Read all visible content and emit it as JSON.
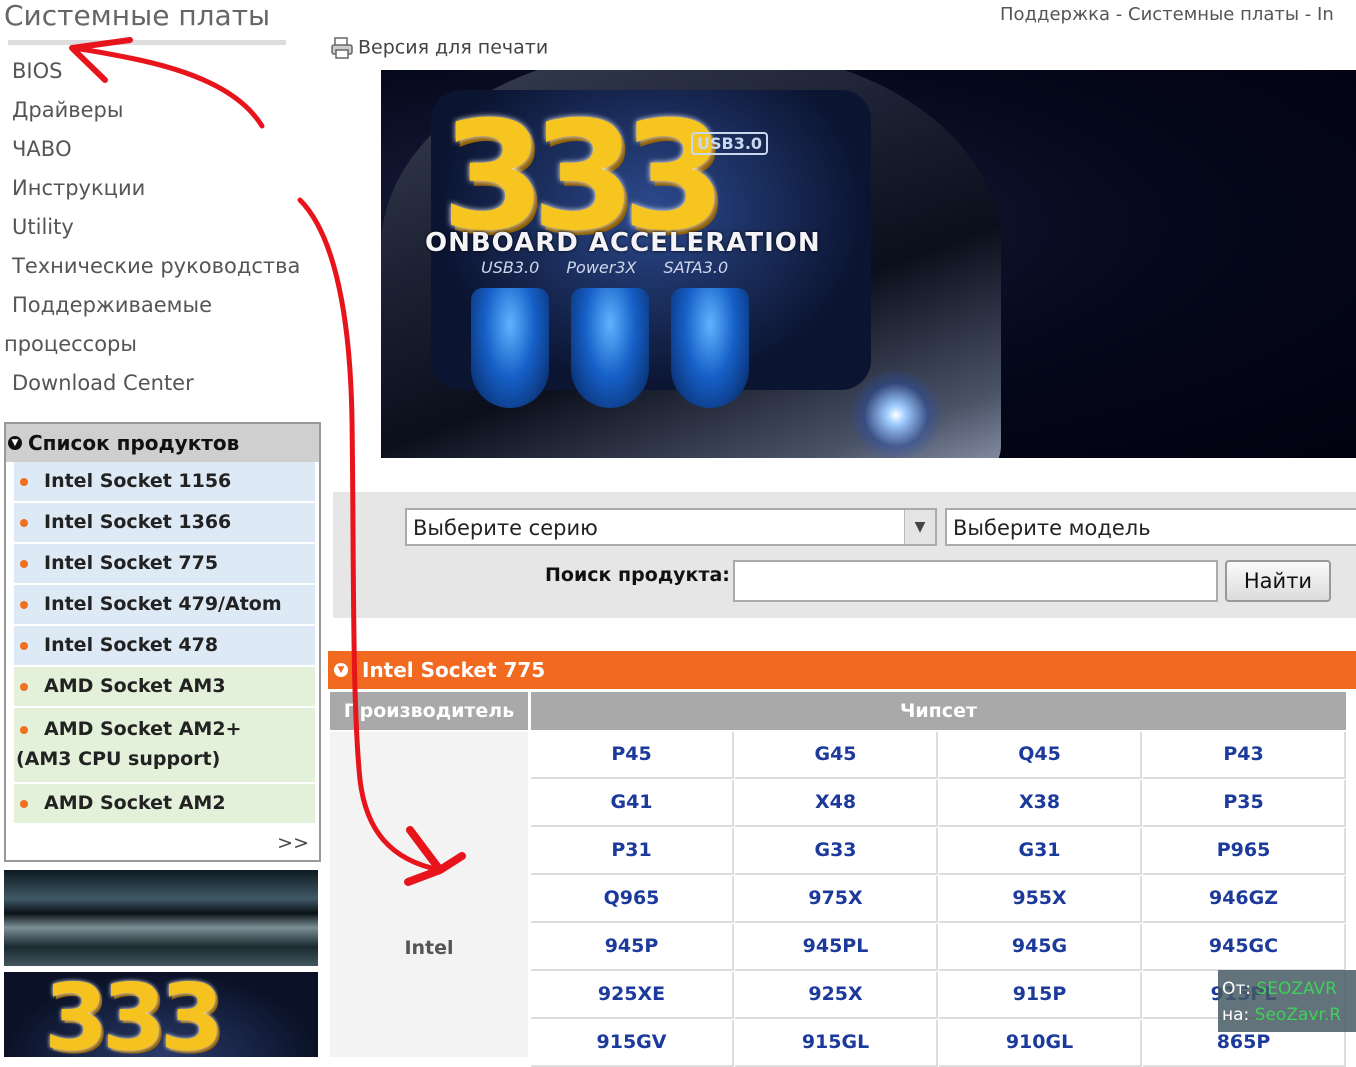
{
  "header": {
    "page_title": "Системные платы",
    "breadcrumb": "Поддержка - Системные платы - In"
  },
  "left_nav": {
    "items": [
      "BIOS",
      "Драйверы",
      "ЧАВО",
      "Инструкции",
      "Utility",
      "Технические руководства"
    ],
    "multi_line_item": {
      "line1": "Поддерживаемые",
      "line2": "процессоры"
    },
    "last_item": "Download Center"
  },
  "product_list": {
    "title": "Список продуктов",
    "items": [
      "Intel Socket 1156",
      "Intel Socket 1366",
      "Intel Socket 775",
      "Intel Socket 479/Atom",
      "Intel Socket 478",
      "AMD Socket AM3"
    ],
    "tall_item": {
      "line1": "AMD Socket AM2+",
      "line2": "(AM3 CPU support)"
    },
    "last_item": "AMD Socket AM2",
    "more": ">>"
  },
  "thumb_banner_text": "333",
  "print_link": "Версия для печати",
  "banner": {
    "big_text": "333",
    "usb_badge": "USB3.0",
    "tagline": "ONBOARD ACCELERATION",
    "sub": "USB3.0 Power3X SATA3.0"
  },
  "search": {
    "series_placeholder": "Выберите серию",
    "model_placeholder": "Выберите модель",
    "label": "Поиск продукта:",
    "button": "Найти"
  },
  "section": {
    "title": "Intel Socket 775",
    "col_manufacturer": "Производитель",
    "col_chipset": "Чипсет",
    "manufacturer": "Intel",
    "chipsets": [
      [
        "P45",
        "G45",
        "Q45",
        "P43"
      ],
      [
        "G41",
        "X48",
        "X38",
        "P35"
      ],
      [
        "P31",
        "G33",
        "G31",
        "P965"
      ],
      [
        "Q965",
        "975X",
        "955X",
        "946GZ"
      ],
      [
        "945P",
        "945PL",
        "945G",
        "945GC"
      ],
      [
        "925XE",
        "925X",
        "915P",
        "915PL"
      ],
      [
        "915GV",
        "915GL",
        "910GL",
        "865P"
      ]
    ]
  },
  "watermark": {
    "line1_prefix": "От:",
    "line1_value": "SEOZAVR",
    "line2_prefix": "на:",
    "line2_value": "SeoZavr.R"
  },
  "colors": {
    "accent_orange": "#f26a1f",
    "chipset_link": "#1c3a9c",
    "intel_row": "#dde9f5",
    "amd_row": "#e3f1da",
    "annotation_red": "#e8141b"
  }
}
